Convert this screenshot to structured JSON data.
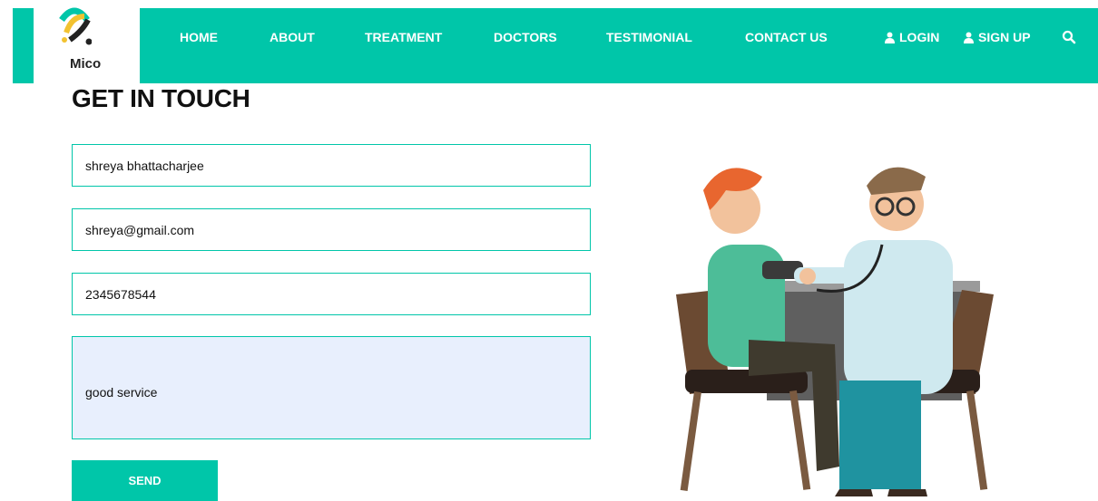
{
  "brand": {
    "name": "Mico"
  },
  "nav": {
    "items": [
      {
        "label": "HOME"
      },
      {
        "label": "ABOUT"
      },
      {
        "label": "TREATMENT"
      },
      {
        "label": "DOCTORS"
      },
      {
        "label": "TESTIMONIAL"
      },
      {
        "label": "CONTACT US"
      }
    ],
    "login_label": "LOGIN",
    "signup_label": "SIGN UP",
    "search_icon": "search-icon"
  },
  "contact": {
    "title": "GET IN TOUCH",
    "name_value": "shreya bhattacharjee",
    "email_value": "shreya@gmail.com",
    "phone_value": "2345678544",
    "message_value": "good service",
    "send_label": "SEND"
  },
  "colors": {
    "accent": "#00c6a9",
    "textarea_bg": "#e8effd"
  },
  "illustration": {
    "icon": "doctor-checkup-illustration"
  }
}
